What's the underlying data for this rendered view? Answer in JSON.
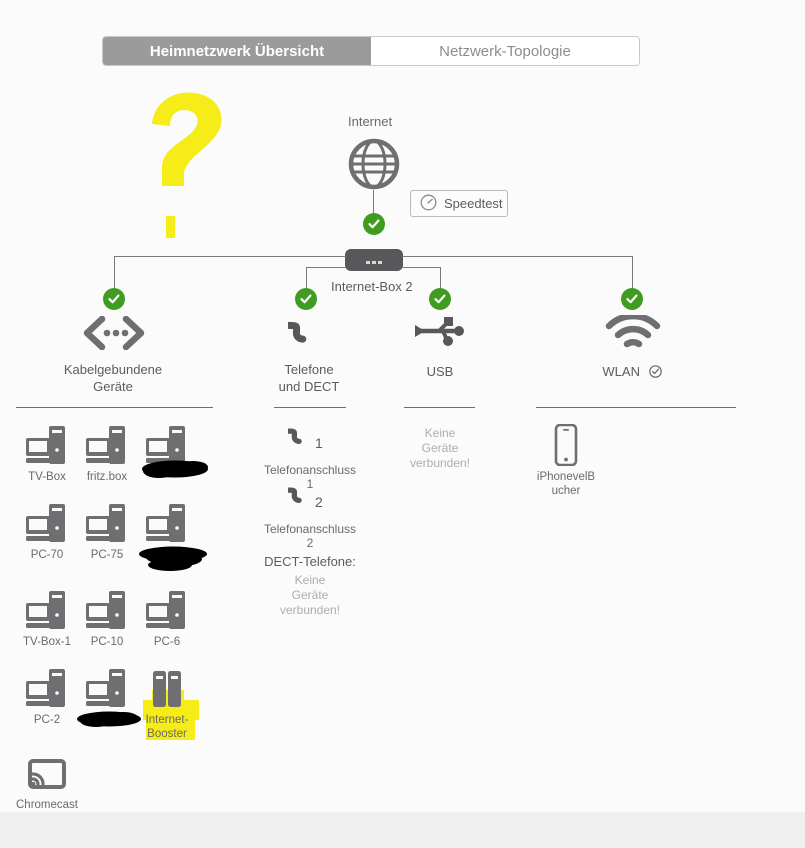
{
  "tabs": [
    {
      "label": "Heimnetzwerk Übersicht",
      "active": true
    },
    {
      "label": "Netzwerk-Topologie",
      "active": false
    }
  ],
  "internet": {
    "label": "Internet",
    "icon": "globe-icon",
    "status": "connected",
    "speedtest_label": "Speedtest",
    "speedtest_icon": "speedometer-icon"
  },
  "router": {
    "label": "Internet-Box 2",
    "icon": "router-icon"
  },
  "categories": [
    {
      "id": "wired",
      "label": "Kabelgebundene\nGeräte",
      "label_lines": [
        "Kabelgebundene",
        "Geräte"
      ],
      "icon": "wired-devices-icon",
      "status": "connected"
    },
    {
      "id": "phones",
      "label": "Telefone\nund DECT",
      "label_lines": [
        "Telefone",
        "und DECT"
      ],
      "icon": "telephone-handset-icon",
      "status": "connected"
    },
    {
      "id": "usb",
      "label": "USB",
      "label_lines": [
        "USB"
      ],
      "icon": "usb-icon",
      "status": "connected"
    },
    {
      "id": "wlan",
      "label": "WLAN",
      "label_lines": [
        "WLAN"
      ],
      "icon": "wifi-icon",
      "trailing_icon": "check-circle-outline-icon",
      "status": "connected"
    }
  ],
  "wired_devices": [
    {
      "name": "TV-Box",
      "icon": "desktop-pc-icon",
      "redacted": false,
      "highlighted": false
    },
    {
      "name": "fritz.box",
      "icon": "desktop-pc-icon",
      "redacted": false,
      "highlighted": false
    },
    {
      "name": "",
      "icon": "desktop-pc-icon",
      "redacted": true,
      "highlighted": false
    },
    {
      "name": "PC-70",
      "icon": "desktop-pc-icon",
      "redacted": false,
      "highlighted": false
    },
    {
      "name": "PC-75",
      "icon": "desktop-pc-icon",
      "redacted": false,
      "highlighted": false
    },
    {
      "name": "",
      "icon": "desktop-pc-icon",
      "redacted": true,
      "highlighted": false
    },
    {
      "name": "TV-Box-1",
      "icon": "desktop-pc-icon",
      "redacted": false,
      "highlighted": false
    },
    {
      "name": "PC-10",
      "icon": "desktop-pc-icon",
      "redacted": false,
      "highlighted": false
    },
    {
      "name": "PC-6",
      "icon": "desktop-pc-icon",
      "redacted": false,
      "highlighted": false
    },
    {
      "name": "PC-2",
      "icon": "desktop-pc-icon",
      "redacted": false,
      "highlighted": false
    },
    {
      "name": "",
      "icon": "desktop-pc-icon",
      "redacted": true,
      "highlighted": false
    },
    {
      "name": "Internet-Booster",
      "icon": "repeater-icon",
      "redacted": false,
      "highlighted": true
    },
    {
      "name": "Chromecast",
      "icon": "chromecast-icon",
      "redacted": false,
      "highlighted": false
    }
  ],
  "phone_ports": [
    {
      "name": "Telefonanschluss 1",
      "icon": "telephone-handset-icon",
      "badge": "1"
    },
    {
      "name": "Telefonanschluss 2",
      "icon": "telephone-handset-icon",
      "badge": "2"
    }
  ],
  "dect": {
    "heading": "DECT-Telefone:",
    "empty_lines": [
      "Keine",
      "Geräte",
      "verbunden!"
    ]
  },
  "usb_devices": {
    "empty_lines": [
      "Keine",
      "Geräte",
      "verbunden!"
    ]
  },
  "wlan_devices": [
    {
      "name": "iPhonevelBucher",
      "icon": "smartphone-icon"
    }
  ],
  "annotations": [
    {
      "type": "question-mark",
      "color": "#f5ec18"
    },
    {
      "type": "highlight",
      "color": "#f5ec18",
      "target": "Internet-Booster"
    },
    {
      "type": "redaction",
      "color": "#000000",
      "count": 3
    }
  ],
  "colors": {
    "status_green": "#3f9c1e",
    "highlight_yellow": "#f5ec18",
    "tab_active_bg": "#9b9b9b",
    "icon_gray": "#6f6f71",
    "page_bg": "#fbfbfb"
  }
}
